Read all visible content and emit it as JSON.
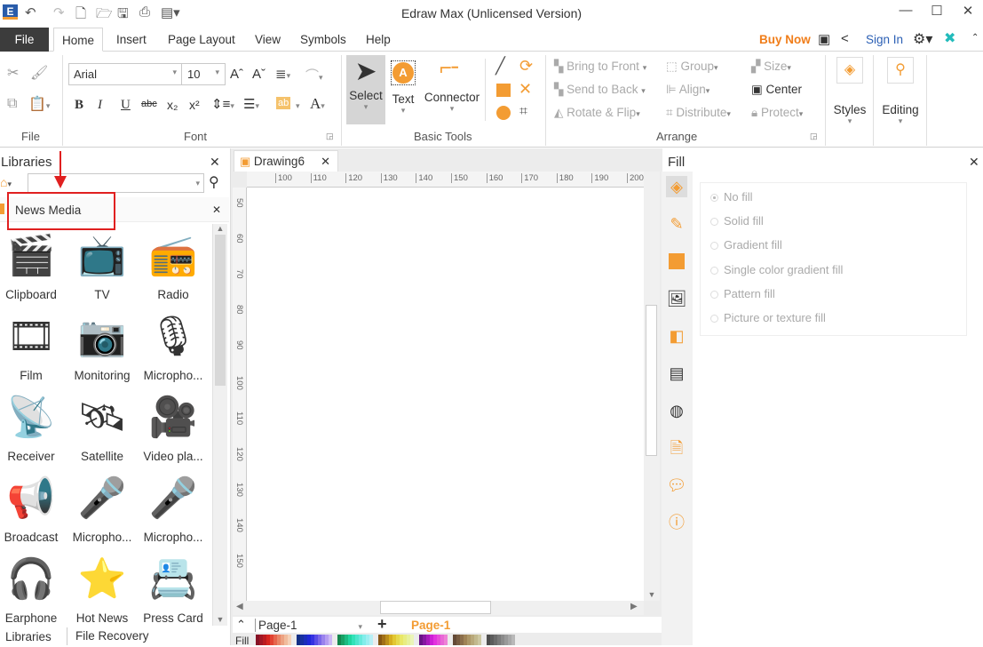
{
  "window": {
    "title": "Edraw Max (Unlicensed Version)"
  },
  "menu": {
    "tabs": [
      "File",
      "Home",
      "Insert",
      "Page Layout",
      "View",
      "Symbols",
      "Help"
    ],
    "active": "Home",
    "buy_now": "Buy Now",
    "sign_in": "Sign In"
  },
  "ribbon": {
    "file_group": "File",
    "font_group": "Font",
    "font_name": "Arial",
    "font_size": "10",
    "basic_tools_group": "Basic Tools",
    "select": "Select",
    "text": "Text",
    "connector": "Connector",
    "arrange_group": "Arrange",
    "arrange": [
      "Bring to Front",
      "Send to Back",
      "Rotate & Flip",
      "Group",
      "Align",
      "Distribute",
      "Size",
      "Center",
      "Protect"
    ],
    "styles": "Styles",
    "editing": "Editing"
  },
  "libraries": {
    "title": "Libraries",
    "search_value": "",
    "category": "News Media",
    "items": [
      {
        "label": "Clipboard",
        "icon": "clapperboard-icon",
        "glyph": "🎬"
      },
      {
        "label": "TV",
        "icon": "tv-icon",
        "glyph": "📺"
      },
      {
        "label": "Radio",
        "icon": "radio-icon",
        "glyph": "📻"
      },
      {
        "label": "Film",
        "icon": "film-reel-icon",
        "glyph": "🎞"
      },
      {
        "label": "Monitoring",
        "icon": "webcam-icon",
        "glyph": "📷"
      },
      {
        "label": "Micropho...",
        "icon": "microphone-icon",
        "glyph": "🎙"
      },
      {
        "label": "Receiver",
        "icon": "router-icon",
        "glyph": "📡"
      },
      {
        "label": "Satellite",
        "icon": "satellite-icon",
        "glyph": "🛰"
      },
      {
        "label": "Video pla...",
        "icon": "video-camera-icon",
        "glyph": "🎥"
      },
      {
        "label": "Broadcast",
        "icon": "megaphone-icon",
        "glyph": "📢"
      },
      {
        "label": "Micropho...",
        "icon": "handheld-microphone-icon",
        "glyph": "🎤"
      },
      {
        "label": "Micropho...",
        "icon": "reporter-microphone-icon",
        "glyph": "🎤"
      },
      {
        "label": "Earphone",
        "icon": "headset-icon",
        "glyph": "🎧"
      },
      {
        "label": "Hot News",
        "icon": "hot-news-icon",
        "glyph": "⭐"
      },
      {
        "label": "Press Card",
        "icon": "press-card-icon",
        "glyph": "📇"
      }
    ],
    "bottom_tabs": [
      "Libraries",
      "File Recovery"
    ]
  },
  "document": {
    "tab": "Drawing6",
    "h_ruler": [
      "100",
      "110",
      "120",
      "130",
      "140",
      "150",
      "160",
      "170",
      "180",
      "190",
      "200"
    ],
    "v_ruler": [
      "50",
      "60",
      "70",
      "80",
      "90",
      "100",
      "110",
      "120",
      "130",
      "140",
      "150"
    ]
  },
  "pages": {
    "current": "Page-1",
    "active_tab": "Page-1",
    "fill_label": "Fill"
  },
  "fill_panel": {
    "title": "Fill",
    "options": [
      "No fill",
      "Solid fill",
      "Gradient fill",
      "Single color gradient fill",
      "Pattern fill",
      "Picture or texture fill"
    ],
    "selected": "No fill"
  },
  "colors": {
    "accent": "#f39c33",
    "buy_now": "#f07d19",
    "sign_in": "#2b5fb4",
    "annotation": "#e02020"
  }
}
